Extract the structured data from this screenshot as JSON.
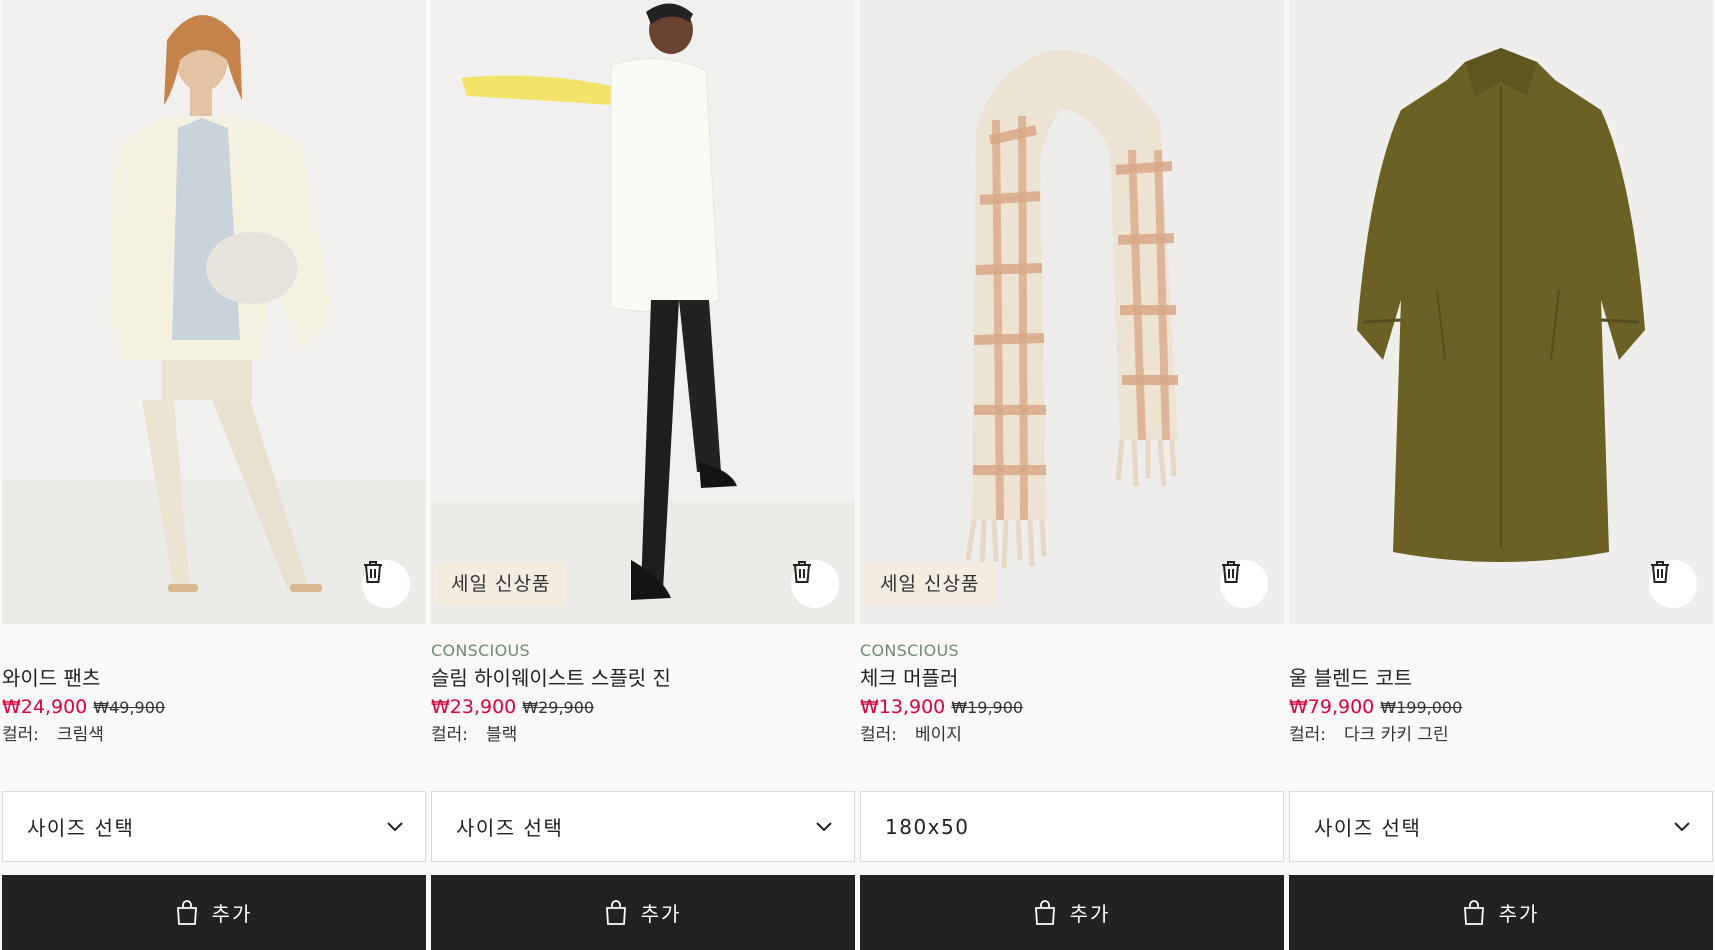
{
  "products": [
    {
      "tag": "",
      "name": "와이드 팬츠",
      "price_sale": "₩24,900",
      "price_original": "₩49,900",
      "color_label": "컬러:",
      "color_value": "크림색",
      "badge": "",
      "size_select": "사이즈 선택",
      "has_dropdown": true,
      "add_label": "추가"
    },
    {
      "tag": "CONSCIOUS",
      "name": "슬림 하이웨이스트 스플릿 진",
      "price_sale": "₩23,900",
      "price_original": "₩29,900",
      "color_label": "컬러:",
      "color_value": "블랙",
      "badge": "세일 신상품",
      "size_select": "사이즈 선택",
      "has_dropdown": true,
      "add_label": "추가"
    },
    {
      "tag": "CONSCIOUS",
      "name": "체크 머플러",
      "price_sale": "₩13,900",
      "price_original": "₩19,900",
      "color_label": "컬러:",
      "color_value": "베이지",
      "badge": "세일 신상품",
      "size_select": "180x50",
      "has_dropdown": false,
      "add_label": "추가"
    },
    {
      "tag": "",
      "name": "울 블렌드 코트",
      "price_sale": "₩79,900",
      "price_original": "₩199,000",
      "color_label": "컬러:",
      "color_value": "다크 카키 그린",
      "badge": "",
      "size_select": "사이즈 선택",
      "has_dropdown": true,
      "add_label": "추가"
    }
  ],
  "colors": {
    "sale_red": "#d6003c",
    "conscious_green": "#6f8a72",
    "button_dark": "#222222",
    "badge_bg": "#f4ecdf"
  },
  "icons": {
    "remove": "trash-icon",
    "dropdown": "chevron-down-icon",
    "add": "shopping-bag-icon"
  }
}
